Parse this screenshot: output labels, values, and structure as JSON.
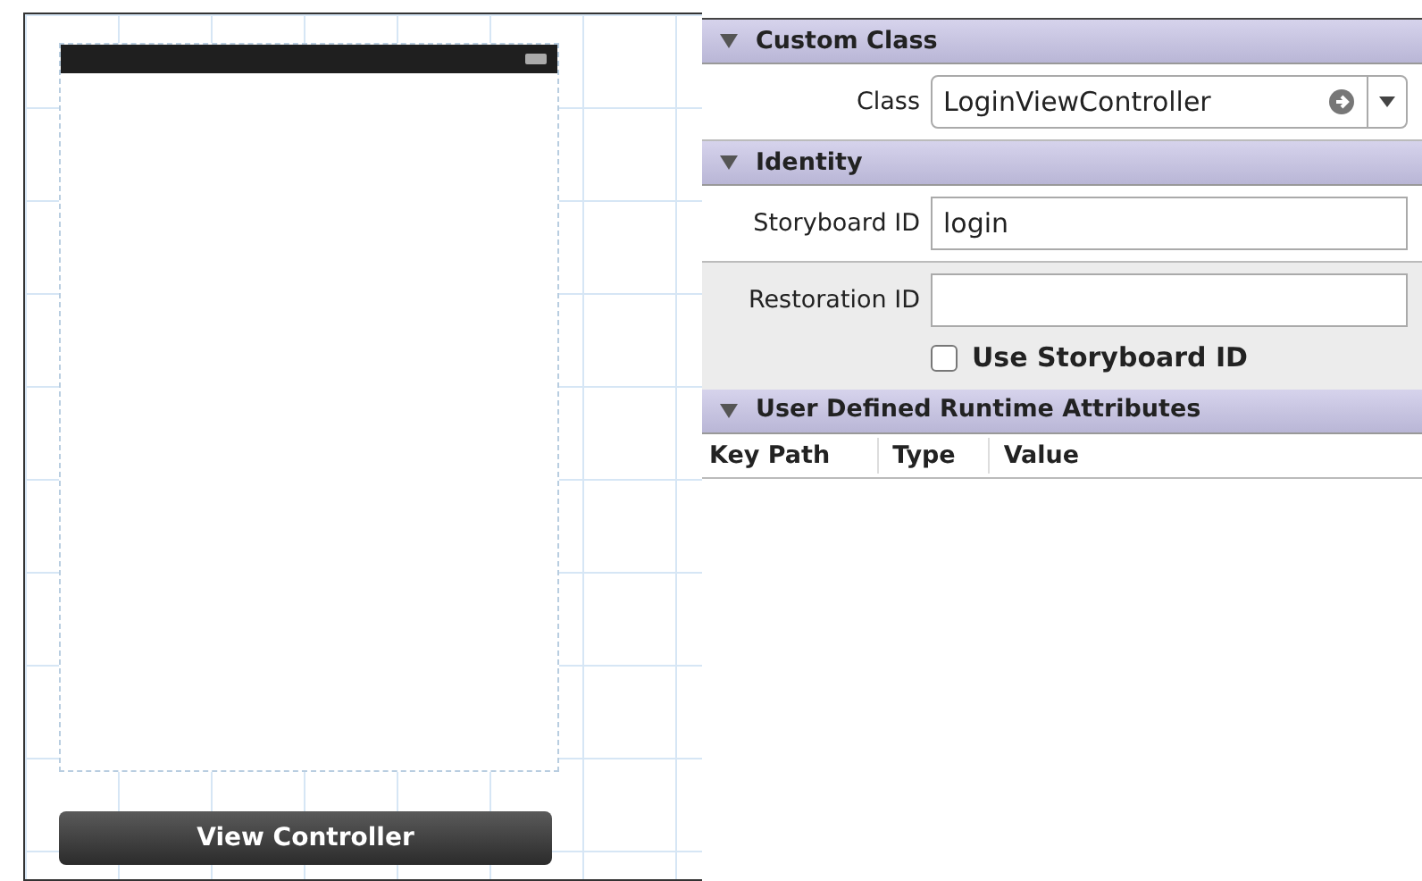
{
  "scene": {
    "dock_label": "View Controller"
  },
  "sections": [
    {
      "title": "Custom Class",
      "expanded": true,
      "rows": [
        {
          "kind": "combo",
          "label": "Class",
          "value": "LoginViewController"
        }
      ]
    },
    {
      "title": "Identity",
      "expanded": true,
      "rows": [
        {
          "kind": "field",
          "label": "Storyboard ID",
          "value": "login"
        },
        {
          "kind": "field",
          "label": "Restoration ID",
          "value": "",
          "shaded": true
        },
        {
          "kind": "checkbox",
          "label": "Use Storyboard ID",
          "checked": false,
          "shaded": true
        }
      ]
    },
    {
      "title": "User Defined Runtime Attributes",
      "expanded": true,
      "rows": [
        {
          "kind": "columns",
          "columns": [
            "Key Path",
            "Type",
            "Value"
          ]
        }
      ]
    }
  ]
}
